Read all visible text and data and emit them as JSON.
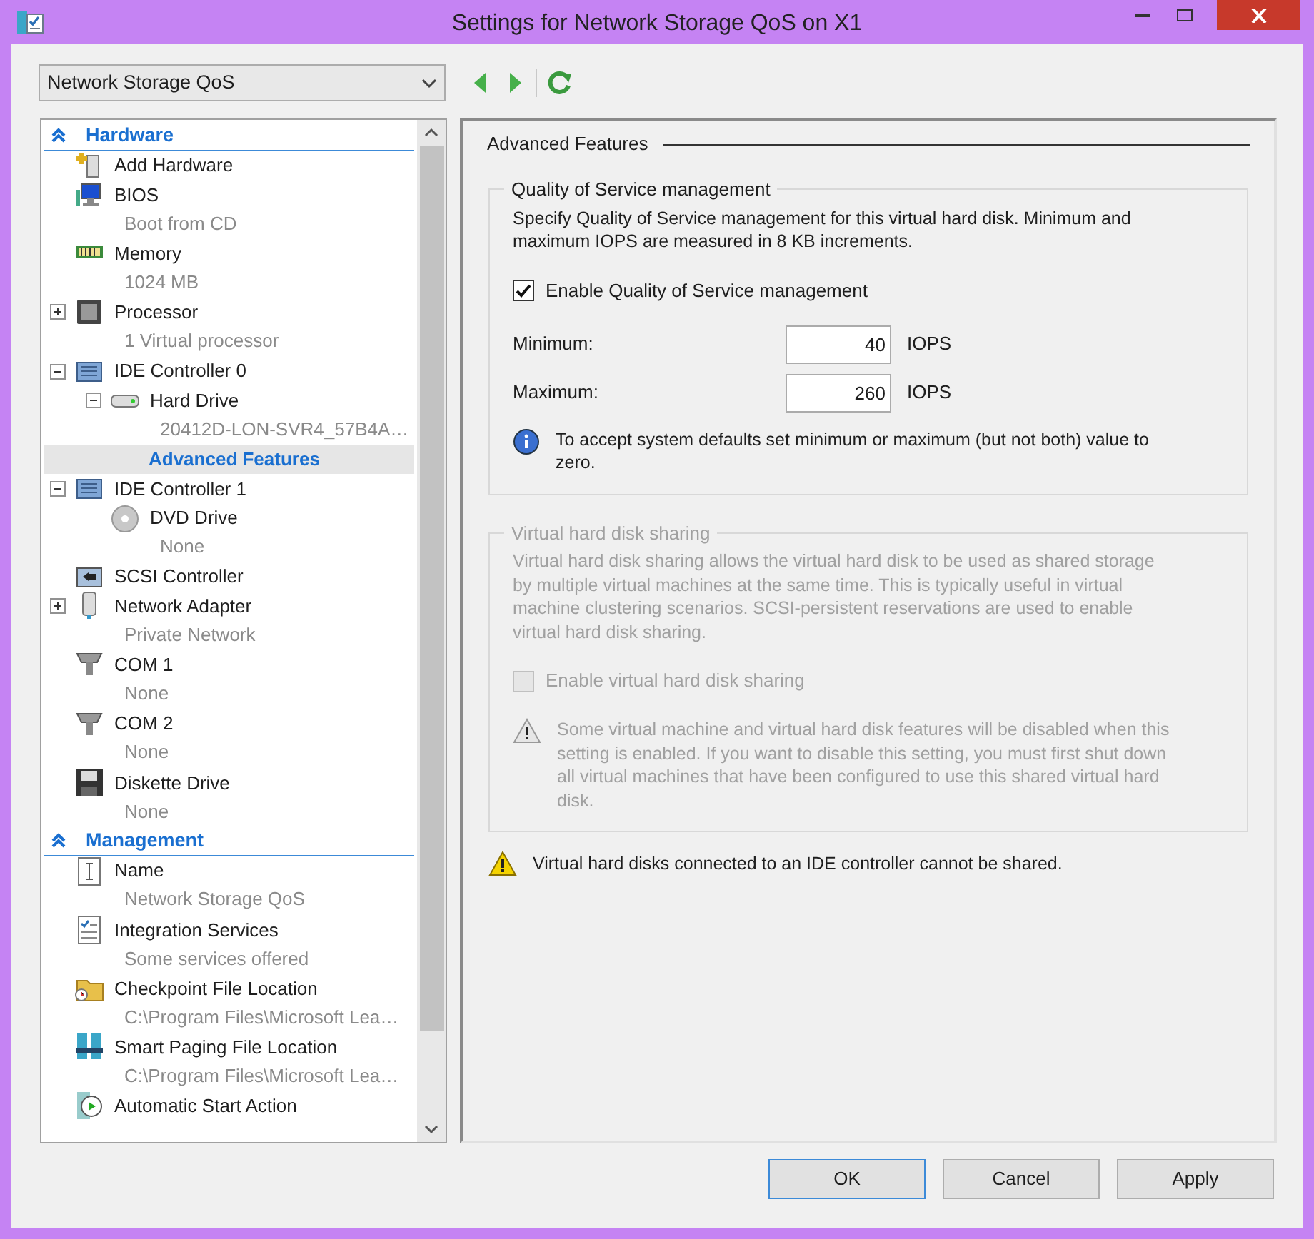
{
  "window": {
    "title": "Settings for Network Storage QoS on X1"
  },
  "vm_selector": {
    "value": "Network Storage QoS"
  },
  "tree": [
    {
      "kind": "section",
      "label": "Hardware",
      "expanded": true,
      "selected": false,
      "children": [
        {
          "kind": "item",
          "label": "Add Hardware",
          "selected": false
        },
        {
          "kind": "item",
          "label": "BIOS",
          "detail": "Boot from CD",
          "selected": false
        },
        {
          "kind": "item",
          "label": "Memory",
          "detail": "1024 MB",
          "selected": false
        },
        {
          "kind": "item",
          "label": "Processor",
          "detail": "1 Virtual processor",
          "expanded": false,
          "selected": false
        },
        {
          "kind": "item",
          "label": "IDE Controller 0",
          "expanded": true,
          "selected": false,
          "children": [
            {
              "kind": "item",
              "label": "Hard Drive",
              "detail": "20412D-LON-SVR4_57B4A…",
              "expanded": true,
              "selected": false,
              "children": [
                {
                  "kind": "subpage",
                  "label": "Advanced Features",
                  "selected": true
                }
              ]
            }
          ]
        },
        {
          "kind": "item",
          "label": "IDE Controller 1",
          "expanded": true,
          "selected": false,
          "children": [
            {
              "kind": "item",
              "label": "DVD Drive",
              "detail": "None",
              "selected": false
            }
          ]
        },
        {
          "kind": "item",
          "label": "SCSI Controller",
          "selected": false
        },
        {
          "kind": "item",
          "label": "Network Adapter",
          "detail": "Private Network",
          "expanded": false,
          "selected": false
        },
        {
          "kind": "item",
          "label": "COM 1",
          "detail": "None",
          "selected": false
        },
        {
          "kind": "item",
          "label": "COM 2",
          "detail": "None",
          "selected": false
        },
        {
          "kind": "item",
          "label": "Diskette Drive",
          "detail": "None",
          "selected": false
        }
      ]
    },
    {
      "kind": "section",
      "label": "Management",
      "expanded": true,
      "selected": false,
      "children": [
        {
          "kind": "item",
          "label": "Name",
          "detail": "Network Storage QoS",
          "selected": false
        },
        {
          "kind": "item",
          "label": "Integration Services",
          "detail": "Some services offered",
          "selected": false
        },
        {
          "kind": "item",
          "label": "Checkpoint File Location",
          "detail": "C:\\Program Files\\Microsoft Lea…",
          "selected": false
        },
        {
          "kind": "item",
          "label": "Smart Paging File Location",
          "detail": "C:\\Program Files\\Microsoft Lea…",
          "selected": false
        },
        {
          "kind": "item",
          "label": "Automatic Start Action",
          "selected": false
        }
      ]
    }
  ],
  "panel": {
    "heading": "Advanced Features",
    "groups": [
      {
        "title": "Quality of Service management",
        "enabled": true,
        "description": "Specify Quality of Service management for this virtual hard disk. Minimum and maximum IOPS are measured in 8 KB increments.",
        "checkbox": {
          "label": "Enable Quality of Service management",
          "checked": true
        },
        "fields": [
          {
            "label": "Minimum:",
            "value": "40",
            "unit": "IOPS"
          },
          {
            "label": "Maximum:",
            "value": "260",
            "unit": "IOPS"
          }
        ],
        "note": {
          "kind": "info",
          "text": "To accept system defaults set minimum or maximum (but not both) value to zero."
        }
      },
      {
        "title": "Virtual hard disk sharing",
        "enabled": false,
        "description": "Virtual hard disk sharing allows the virtual hard disk to be used as shared storage by multiple virtual machines at the same time. This is typically useful in virtual machine clustering scenarios. SCSI-persistent reservations are used to enable virtual hard disk sharing.",
        "checkbox": {
          "label": "Enable virtual hard disk sharing",
          "checked": false
        },
        "note": {
          "kind": "warning",
          "text": "Some virtual machine and virtual hard disk features will be disabled when this setting is enabled. If you want to disable this setting, you must first shut down all virtual machines that have been configured to use this shared virtual hard disk."
        }
      }
    ],
    "footer_note": {
      "kind": "warning",
      "text": "Virtual hard disks connected to an IDE controller cannot be shared."
    }
  },
  "buttons": [
    {
      "label": "OK",
      "default": true
    },
    {
      "label": "Cancel",
      "default": false
    },
    {
      "label": "Apply",
      "default": false
    }
  ]
}
